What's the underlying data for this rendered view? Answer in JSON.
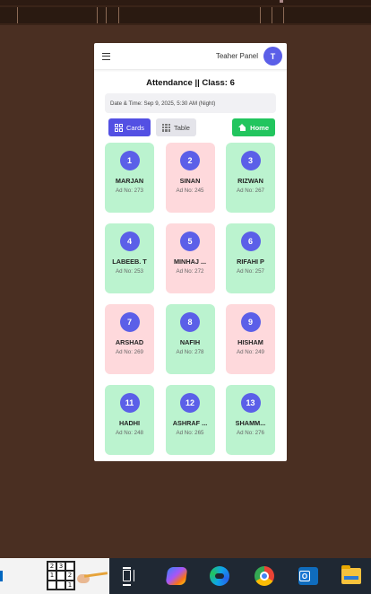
{
  "header": {
    "panel_label": "Teaher Panel",
    "avatar_initial": "T"
  },
  "page": {
    "title": "Attendance || Class: 6",
    "datetime": "Date & Time: Sep 9, 2025, 5:30 AM (Night)"
  },
  "controls": {
    "cards_label": "Cards",
    "table_label": "Table",
    "home_label": "Home"
  },
  "colors": {
    "accent": "#5b5fe8",
    "present_bg": "#bbf3cf",
    "absent_bg": "#fed9dc",
    "home_button": "#22c55e"
  },
  "students": [
    {
      "roll": "1",
      "name": "MARJAN",
      "adno": "Ad No: 273",
      "status": "present"
    },
    {
      "roll": "2",
      "name": "SINAN",
      "adno": "Ad No: 245",
      "status": "absent"
    },
    {
      "roll": "3",
      "name": "RIZWAN",
      "adno": "Ad No: 267",
      "status": "present"
    },
    {
      "roll": "4",
      "name": "LABEEB. T",
      "adno": "Ad No: 253",
      "status": "present"
    },
    {
      "roll": "5",
      "name": "MINHAJ ...",
      "adno": "Ad No: 272",
      "status": "absent"
    },
    {
      "roll": "6",
      "name": "RIFAHI P",
      "adno": "Ad No: 257",
      "status": "present"
    },
    {
      "roll": "7",
      "name": "ARSHAD",
      "adno": "Ad No: 269",
      "status": "absent"
    },
    {
      "roll": "8",
      "name": "NAFIH",
      "adno": "Ad No: 278",
      "status": "present"
    },
    {
      "roll": "9",
      "name": "HISHAM",
      "adno": "Ad No: 249",
      "status": "absent"
    },
    {
      "roll": "11",
      "name": "HADHI",
      "adno": "Ad No: 248",
      "status": "present"
    },
    {
      "roll": "12",
      "name": "ASHRAF ...",
      "adno": "Ad No: 265",
      "status": "present"
    },
    {
      "roll": "13",
      "name": "SHAMM...",
      "adno": "Ad No: 276",
      "status": "present"
    }
  ],
  "taskbar": {
    "sudoku_cells": [
      "2",
      "3",
      "",
      "1",
      "",
      "2",
      "",
      "",
      "1"
    ],
    "apps": [
      "task-view-icon",
      "copilot-icon",
      "edge-icon",
      "chrome-icon",
      "outlook-icon",
      "file-explorer-icon"
    ],
    "outlook_letter": "O"
  }
}
